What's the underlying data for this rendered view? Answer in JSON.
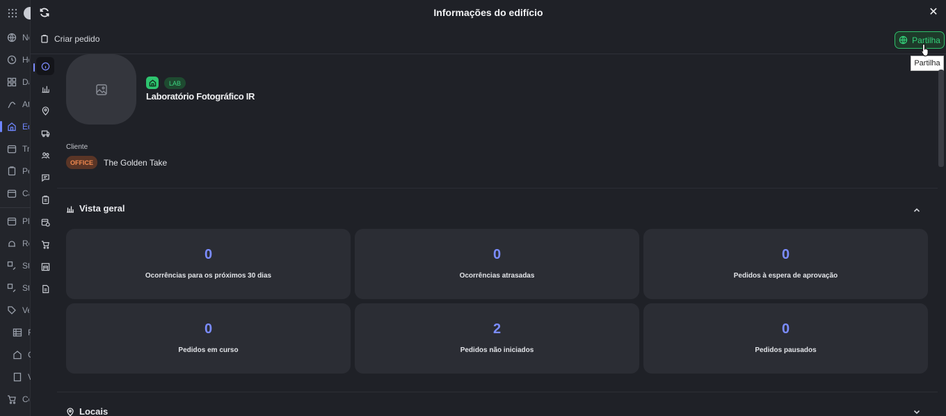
{
  "app": {
    "nav_labels": [
      "Ne",
      "Ho",
      "Da",
      "At",
      "Ed",
      "Tr",
      "Pe",
      "Ca",
      "Pl",
      "Re",
      "St",
      "St",
      "Ve",
      "F",
      "C",
      "V",
      "Co"
    ]
  },
  "modal": {
    "title": "Informações do edifício",
    "create_order_label": "Criar pedido",
    "share_label": "Partilha",
    "share_tooltip": "Partilha"
  },
  "building": {
    "badge": "LAB",
    "name": "Laboratório Fotográfico IR",
    "client_label": "Cliente",
    "client_badge": "OFFICE",
    "client_name": "The Golden Take"
  },
  "overview": {
    "title": "Vista geral",
    "cards": [
      {
        "value": "0",
        "label": "Ocorrências para os próximos 30 dias"
      },
      {
        "value": "0",
        "label": "Ocorrências atrasadas"
      },
      {
        "value": "0",
        "label": "Pedidos à espera de aprovação"
      },
      {
        "value": "0",
        "label": "Pedidos em curso"
      },
      {
        "value": "2",
        "label": "Pedidos não iniciados"
      },
      {
        "value": "0",
        "label": "Pedidos pausados"
      }
    ]
  },
  "locations": {
    "title": "Locais"
  },
  "colors": {
    "accent": "#7b8cff",
    "share_green": "#34d27a",
    "office_orange": "#f0894f"
  }
}
